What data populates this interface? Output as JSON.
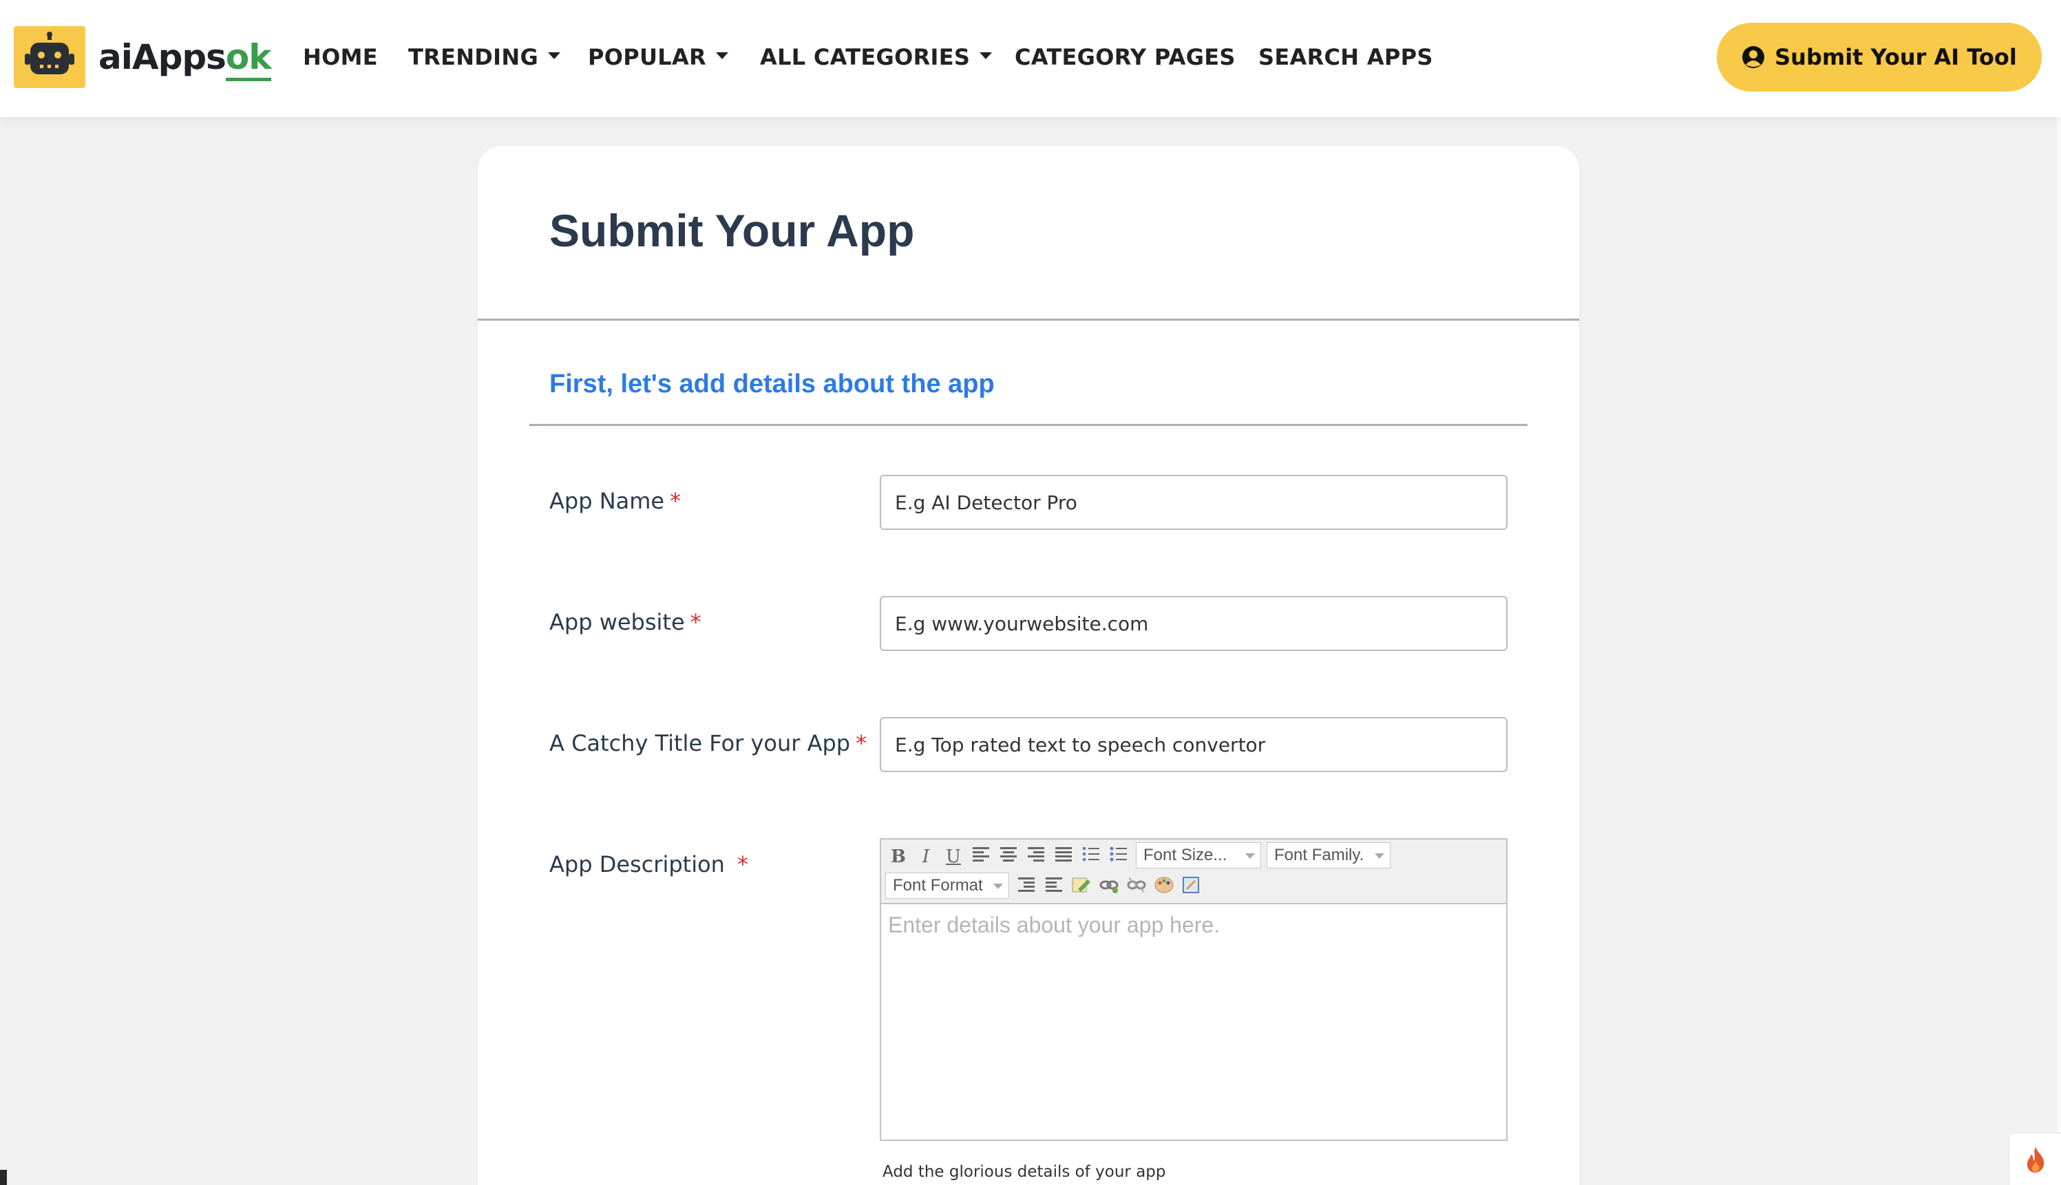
{
  "brand": {
    "name_main": "aiApps",
    "name_accent": "ok",
    "logo_icon": "robot-icon"
  },
  "nav": {
    "items": [
      {
        "label": "HOME",
        "dropdown": false
      },
      {
        "label": "TRENDING",
        "dropdown": true
      },
      {
        "label": "POPULAR",
        "dropdown": true
      },
      {
        "label": "ALL CATEGORIES",
        "dropdown": true
      },
      {
        "label": "CATEGORY PAGES",
        "dropdown": false
      },
      {
        "label": "SEARCH APPS",
        "dropdown": false
      }
    ],
    "cta_label": "Submit Your AI Tool",
    "cta_icon": "user-circle-icon"
  },
  "form": {
    "title": "Submit Your App",
    "section_title": "First, let's add details about the app",
    "fields": {
      "app_name": {
        "label": "App Name",
        "required_mark": "*",
        "placeholder": "E.g AI Detector Pro",
        "value": ""
      },
      "app_website": {
        "label": "App website",
        "required_mark": "*",
        "placeholder": "E.g www.yourwebsite.com",
        "value": ""
      },
      "catchy_title": {
        "label": "A Catchy Title For your App",
        "required_mark": "*",
        "placeholder": "E.g Top rated text to speech convertor",
        "value": ""
      },
      "description": {
        "label": "App Description",
        "required_mark": "*",
        "placeholder": "Enter details about your app here.",
        "helper": "Add the glorious details of your app"
      }
    },
    "editor_toolbar": {
      "font_size": "Font Size...",
      "font_family": "Font Family.",
      "font_format": "Font Format",
      "bold": "B",
      "italic": "I",
      "underline": "U"
    }
  },
  "colors": {
    "accent_yellow": "#f8c948",
    "brand_green": "#3b9c4a",
    "section_blue": "#2c7be5",
    "required_red": "#d32f2f",
    "page_bg": "#f1f1f2"
  },
  "widgets": {
    "corner_icon": "fire-icon"
  }
}
